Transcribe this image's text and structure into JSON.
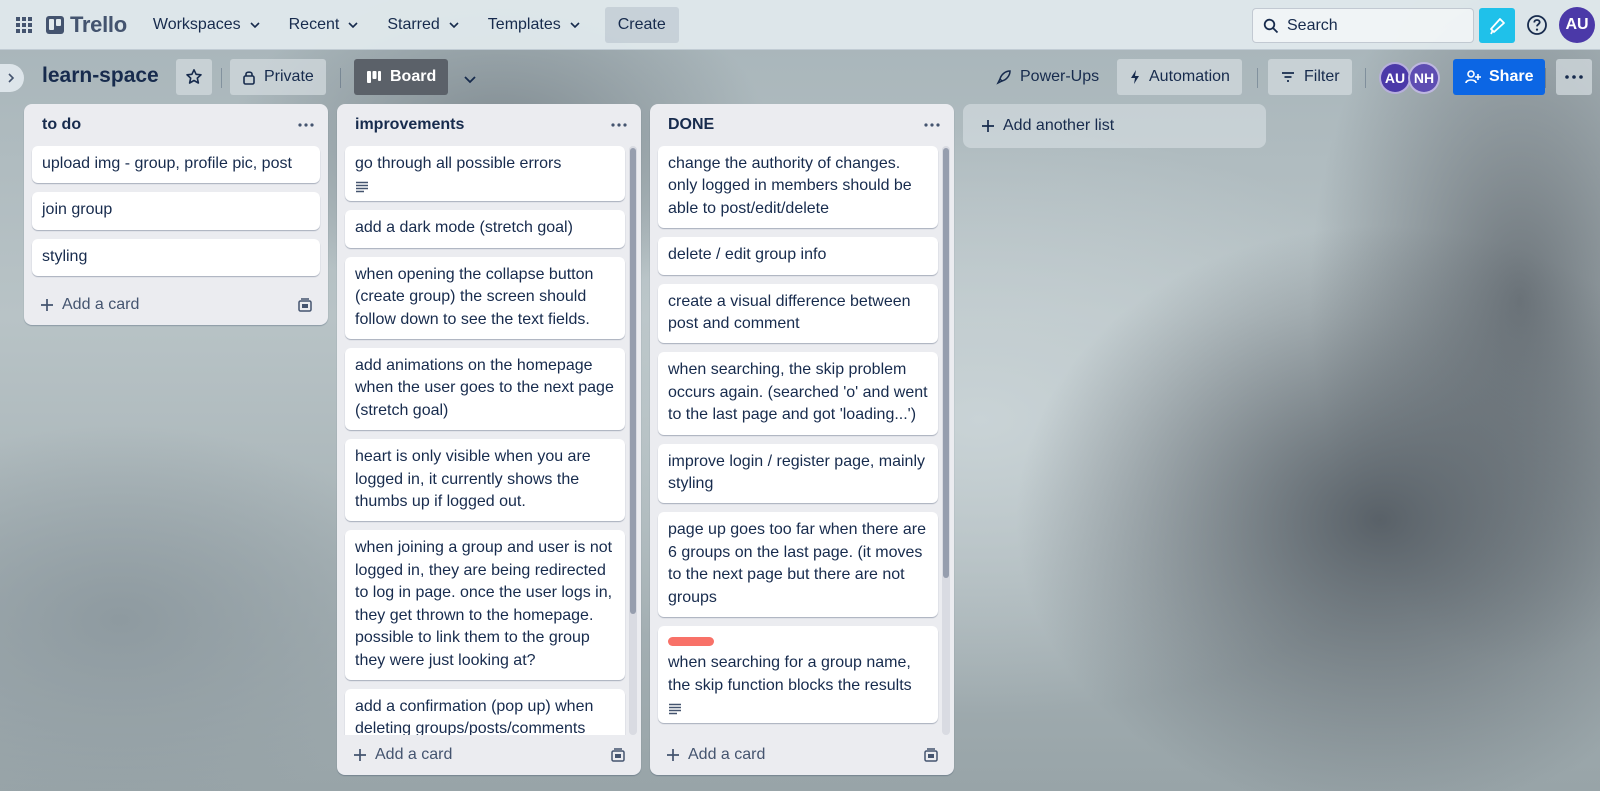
{
  "nav": {
    "logo": "Trello",
    "workspaces": "Workspaces",
    "recent": "Recent",
    "starred": "Starred",
    "templates": "Templates",
    "create": "Create",
    "search_placeholder": "Search",
    "user_initials": "AU"
  },
  "board": {
    "title": "learn-space",
    "visibility": "Private",
    "view": "Board",
    "powerups": "Power-Ups",
    "automation": "Automation",
    "filter": "Filter",
    "members": [
      "AU",
      "NH"
    ],
    "share": "Share",
    "add_list": "Add another list"
  },
  "lists": [
    {
      "title": "to do",
      "cards": [
        {
          "text": "upload img - group, profile pic, post"
        },
        {
          "text": "join group"
        },
        {
          "text": "styling"
        }
      ],
      "add_card": "Add a card"
    },
    {
      "title": "improvements",
      "cards": [
        {
          "text": "go through all possible errors",
          "has_description": true
        },
        {
          "text": "add a dark mode (stretch goal)"
        },
        {
          "text": "when opening the collapse button (create group) the screen should follow down to see the text fields."
        },
        {
          "text": "add animations on the homepage when the user goes to the next page (stretch goal)"
        },
        {
          "text": "heart is only visible when you are logged in, it currently shows the thumbs up if logged out."
        },
        {
          "text": "when joining a group and user is not logged in, they are being redirected to log in page. once the user logs in, they get thrown to the homepage. possible to link them to the group they were just looking at?"
        },
        {
          "text": "add a confirmation (pop up) when deleting groups/posts/comments"
        }
      ],
      "add_card": "Add a card"
    },
    {
      "title": "DONE",
      "cards": [
        {
          "text": "change the authority of changes. only logged in members should be able to post/edit/delete"
        },
        {
          "text": "delete / edit group info"
        },
        {
          "text": "create a visual difference between post and comment"
        },
        {
          "text": "when searching, the skip problem occurs again. (searched 'o' and went to the last page and got 'loading...')"
        },
        {
          "text": "improve login / register page, mainly styling"
        },
        {
          "text": "page up goes too far when there are 6 groups on the last page. (it moves to the next page but there are not groups"
        },
        {
          "text": "when searching for a group name, the skip function blocks the results",
          "label_color": "#f87168",
          "has_description": true
        }
      ],
      "add_card": "Add a card"
    }
  ]
}
